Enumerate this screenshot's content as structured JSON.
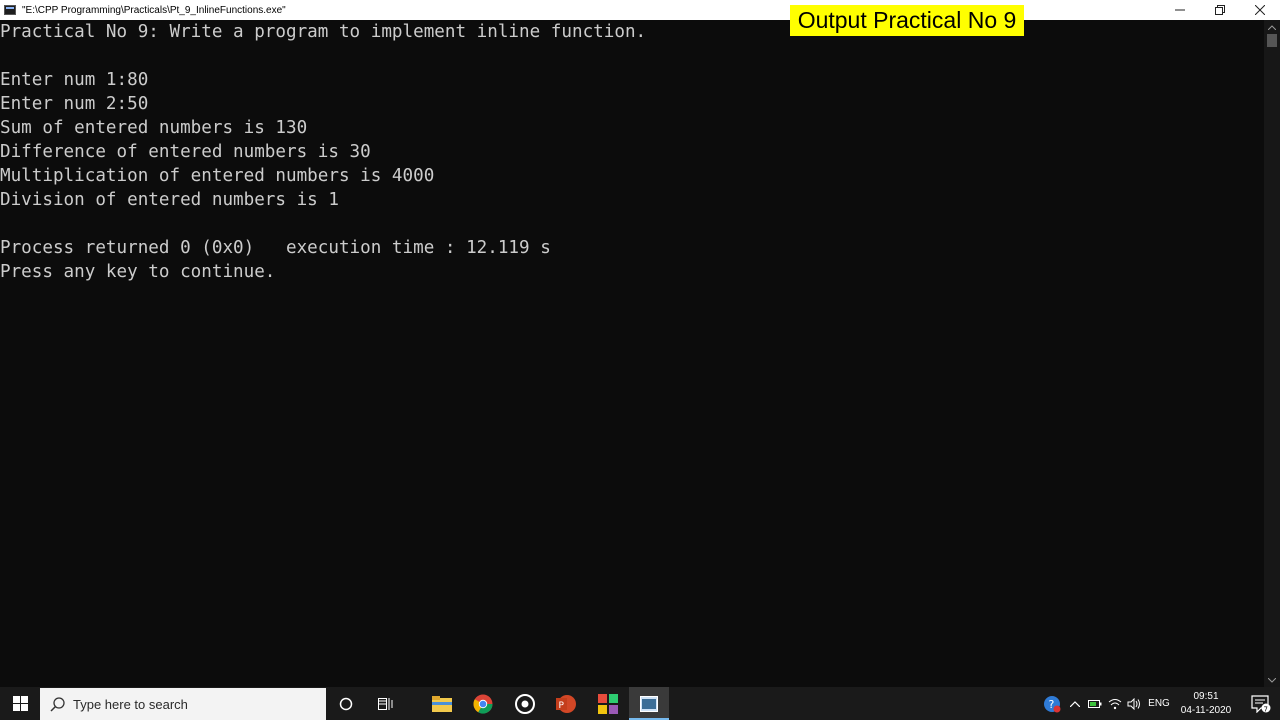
{
  "window": {
    "title": "\"E:\\CPP Programming\\Practicals\\Pt_9_InlineFunctions.exe\""
  },
  "overlay": {
    "label": "Output Practical No 9",
    "background": "#ffff00"
  },
  "console": {
    "background": "#0c0c0c",
    "foreground": "#cccccc",
    "lines": [
      "Practical No 9: Write a program to implement inline function.",
      "",
      "Enter num 1:80",
      "Enter num 2:50",
      "Sum of entered numbers is 130",
      "Difference of entered numbers is 30",
      "Multiplication of entered numbers is 4000",
      "Division of entered numbers is 1",
      "",
      "Process returned 0 (0x0)   execution time : 12.119 s",
      "Press any key to continue."
    ]
  },
  "taskbar": {
    "search_placeholder": "Type here to search",
    "pinned": [
      "cortana-icon",
      "task-view-icon",
      "file-explorer-icon",
      "chrome-icon",
      "media-player-icon",
      "powerpoint-icon",
      "colorful-app-icon",
      "console-app-icon"
    ],
    "language": "ENG",
    "time": "09:51",
    "date": "04-11-2020",
    "notification_count": "7",
    "accent": "#76b9ed"
  }
}
